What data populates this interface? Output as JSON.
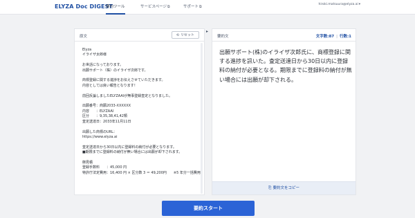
{
  "header": {
    "brand": "ELYZA Doc DIGEST",
    "nav": [
      {
        "label": "要約ツール",
        "external": false
      },
      {
        "label": "サービスページ",
        "external": true
      },
      {
        "label": "サポート",
        "external": true
      }
    ],
    "external_icon": "⧉",
    "user_email": "hiroki.matsuura@elyza.ai",
    "user_caret": "▾"
  },
  "source_panel": {
    "title": "原文",
    "reset_label": "リセット",
    "reset_icon": "⟲",
    "text": "Elyza\nイライザ太郎様\n\nお世話になっております。\n出願サポート（株）のイライザ次郎です。\n\n商標登録に関する進捗をお伝えさせていただきます。\n内容としては良い報告となります！\n\n前回反論しましたELYZAAIが無事登録査定となりました。\n\n出願番号：商願2033-XXXXXX\n内容　　：ELYZAAI\n区分　　：9,35,38,41,42類\n査定送達日：2033年11月11日\n\n出願した商標のURL：\nhttps://www.elyza.ai\n\n査定送達日から30日以内に登録料の納付が必要となります。\n■期限までに登録料の納付が無い場合には出願が却下されます。\n\n御見積\n登録手数料　　：45,000 円\n特許庁法定費用：16,400 円 × 区分数 3 ＝ 49,200円　　※5 年分一括費用"
  },
  "arrow_icon": "▸",
  "summary_panel": {
    "title": "要約文",
    "char_count_label": "文字数:87",
    "line_count_label": "行数:1",
    "text": "出願サポート(株)のイライザ次郎氏に、商標登録に関する進捗を訊いた。査定送達日から30日以内に登録料の納付が必要となる。期限までに登録料の納付が無い場合には出願が却下される。",
    "copy_label": "要約文をコピー",
    "copy_icon": "⎘"
  },
  "start_button_label": "要約スタート",
  "colors": {
    "brand": "#1f4fa3",
    "primary_button": "#2b63d6",
    "copy_bar": "#e9eef6",
    "background": "#f1f2f4"
  }
}
